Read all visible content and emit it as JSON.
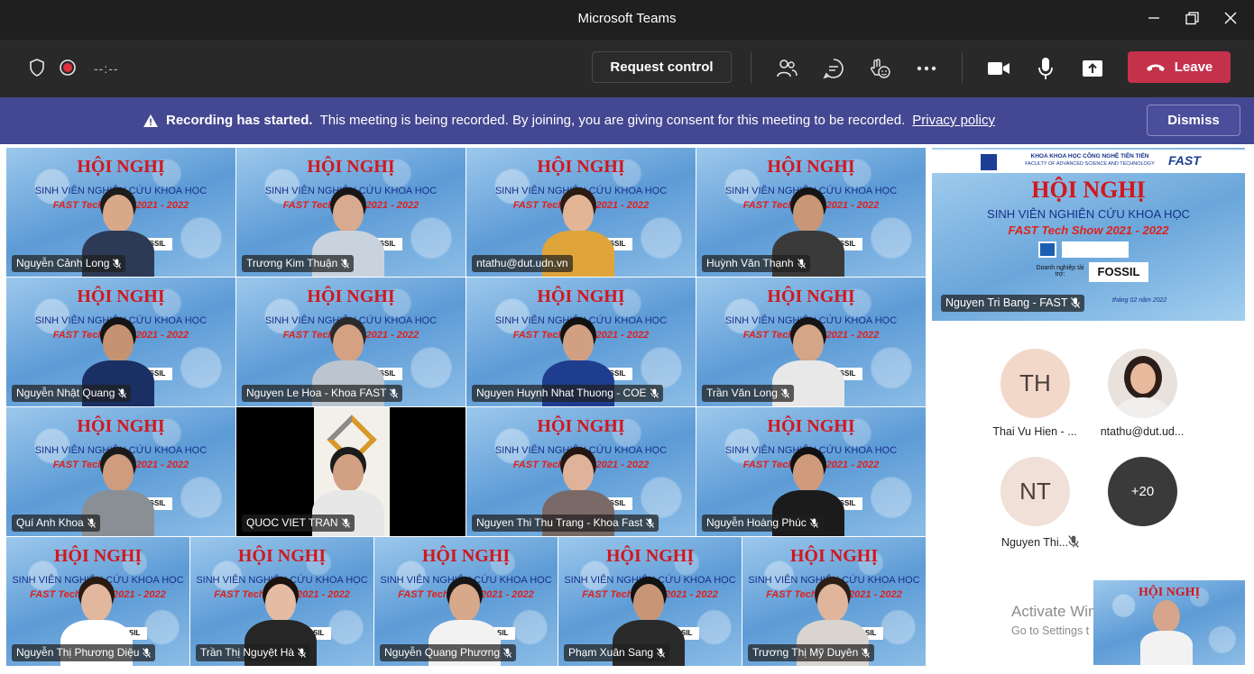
{
  "window": {
    "title": "Microsoft Teams"
  },
  "toolbar": {
    "timer": "--:--",
    "request_control": "Request control",
    "leave": "Leave",
    "icons": [
      "shield-icon",
      "record-icon",
      "participants-icon",
      "chat-icon",
      "reactions-icon",
      "more-icon",
      "camera-icon",
      "mic-icon",
      "share-icon",
      "phone-icon"
    ]
  },
  "banner": {
    "title": "Recording has started.",
    "message": "This meeting is being recorded. By joining, you are giving consent for this meeting to be recorded.",
    "link": "Privacy policy",
    "dismiss": "Dismiss"
  },
  "slide": {
    "heading": "HỘI NGHỊ",
    "subheading": "SINH VIÊN NGHIÊN CỨU KHOA HỌC",
    "event": "FAST Tech Show 2021 - 2022",
    "sponsor_logo": "FOSSIL",
    "sponsor_text": "Doanh nghiệp tài trợ:"
  },
  "featured": {
    "name": "Nguyen Tri Bang - FAST",
    "org_line": "KHOA KHOA HỌC CÔNG NGHỆ TIÊN TIẾN",
    "org_line_en": "FACULTY OF ADVANCED SCIENCE AND TECHNOLOGY",
    "brand": "FAST",
    "date_fragment": "tháng 02 năm 2022"
  },
  "participants": [
    {
      "name": "Nguyễn Cảnh Long"
    },
    {
      "name": "Trương Kim Thuận"
    },
    {
      "name": "ntathu@dut.udn.vn"
    },
    {
      "name": "Huỳnh Văn Thạnh"
    },
    {
      "name": "Nguyễn Nhật Quang"
    },
    {
      "name": "Nguyen Le Hoa - Khoa FAST"
    },
    {
      "name": "Nguyen Huynh Nhat Thuong - COE"
    },
    {
      "name": "Trần Văn Long"
    },
    {
      "name": "Quí Anh Khoa"
    },
    {
      "name": "QUOC VIET TRAN"
    },
    {
      "name": "Nguyen Thi Thu Trang - Khoa Fast"
    },
    {
      "name": "Nguyễn Hoàng Phúc"
    },
    {
      "name": "Nguyễn Thị Phương Diệu"
    },
    {
      "name": "Trần Thị Nguyệt Hà"
    },
    {
      "name": "Nguyễn Quang Phương"
    },
    {
      "name": "Phạm Xuân Sang"
    },
    {
      "name": "Trương Thị Mỹ Duyên"
    }
  ],
  "side_avatars": [
    {
      "initials": "TH",
      "name": "Thai Vu Hien - ..."
    },
    {
      "initials": "",
      "name": "ntathu@dut.ud..."
    },
    {
      "initials": "NT",
      "name": "Nguyen Thi..."
    },
    {
      "initials": "+20",
      "name": ""
    }
  ],
  "watermark": {
    "line1": "Activate Wind",
    "line2": "Go to Settings t"
  },
  "colors": {
    "leave": "#c4314b",
    "banner": "#444791",
    "toolbar": "#292929",
    "titlebar": "#1f1f1f"
  }
}
